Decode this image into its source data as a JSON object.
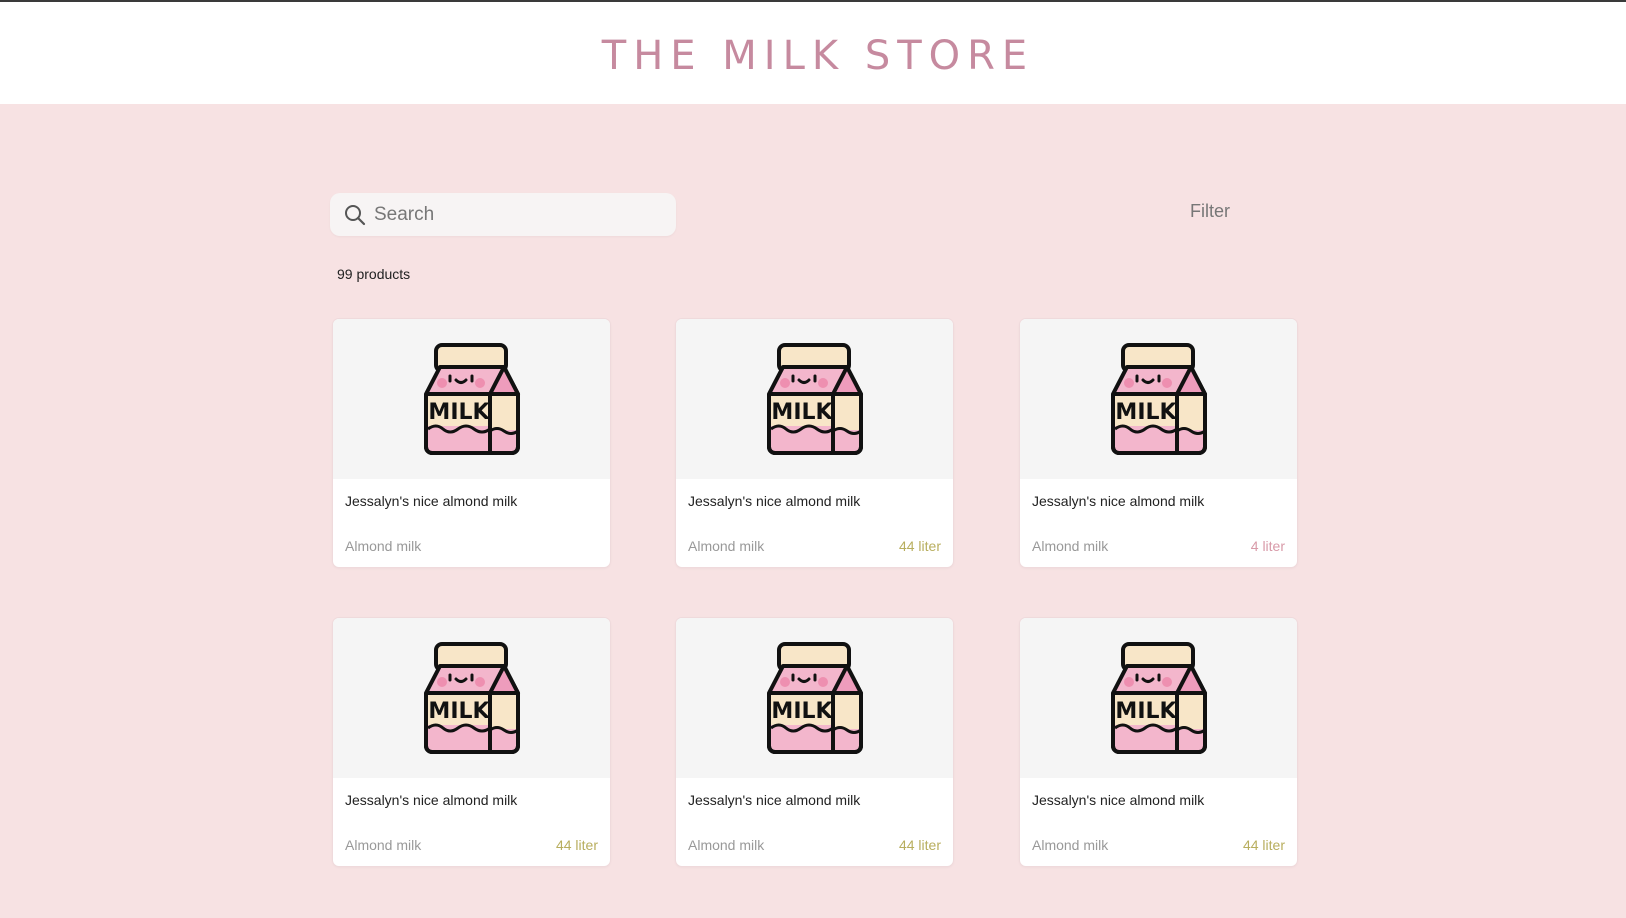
{
  "header": {
    "title": "THE MILK STORE"
  },
  "search": {
    "placeholder": "Search"
  },
  "filter_label": "Filter",
  "product_count": "99 products",
  "colors": {
    "accent": "#c68a9f",
    "background": "#f7e2e3",
    "volume_olive": "#b8ae5e",
    "volume_pink": "#d89aa8"
  },
  "products": [
    {
      "name": "Jessalyn's nice almond milk",
      "category": "Almond milk",
      "volume": "",
      "volume_color": "#b8ae5e"
    },
    {
      "name": "Jessalyn's nice almond milk",
      "category": "Almond milk",
      "volume": "44 liter",
      "volume_color": "#b8ae5e"
    },
    {
      "name": "Jessalyn's nice almond milk",
      "category": "Almond milk",
      "volume": "4 liter",
      "volume_color": "#d89aa8"
    },
    {
      "name": "Jessalyn's nice almond milk",
      "category": "Almond milk",
      "volume": "44 liter",
      "volume_color": "#b8ae5e"
    },
    {
      "name": "Jessalyn's nice almond milk",
      "category": "Almond milk",
      "volume": "44 liter",
      "volume_color": "#b8ae5e"
    },
    {
      "name": "Jessalyn's nice almond milk",
      "category": "Almond milk",
      "volume": "44 liter",
      "volume_color": "#b8ae5e"
    }
  ]
}
